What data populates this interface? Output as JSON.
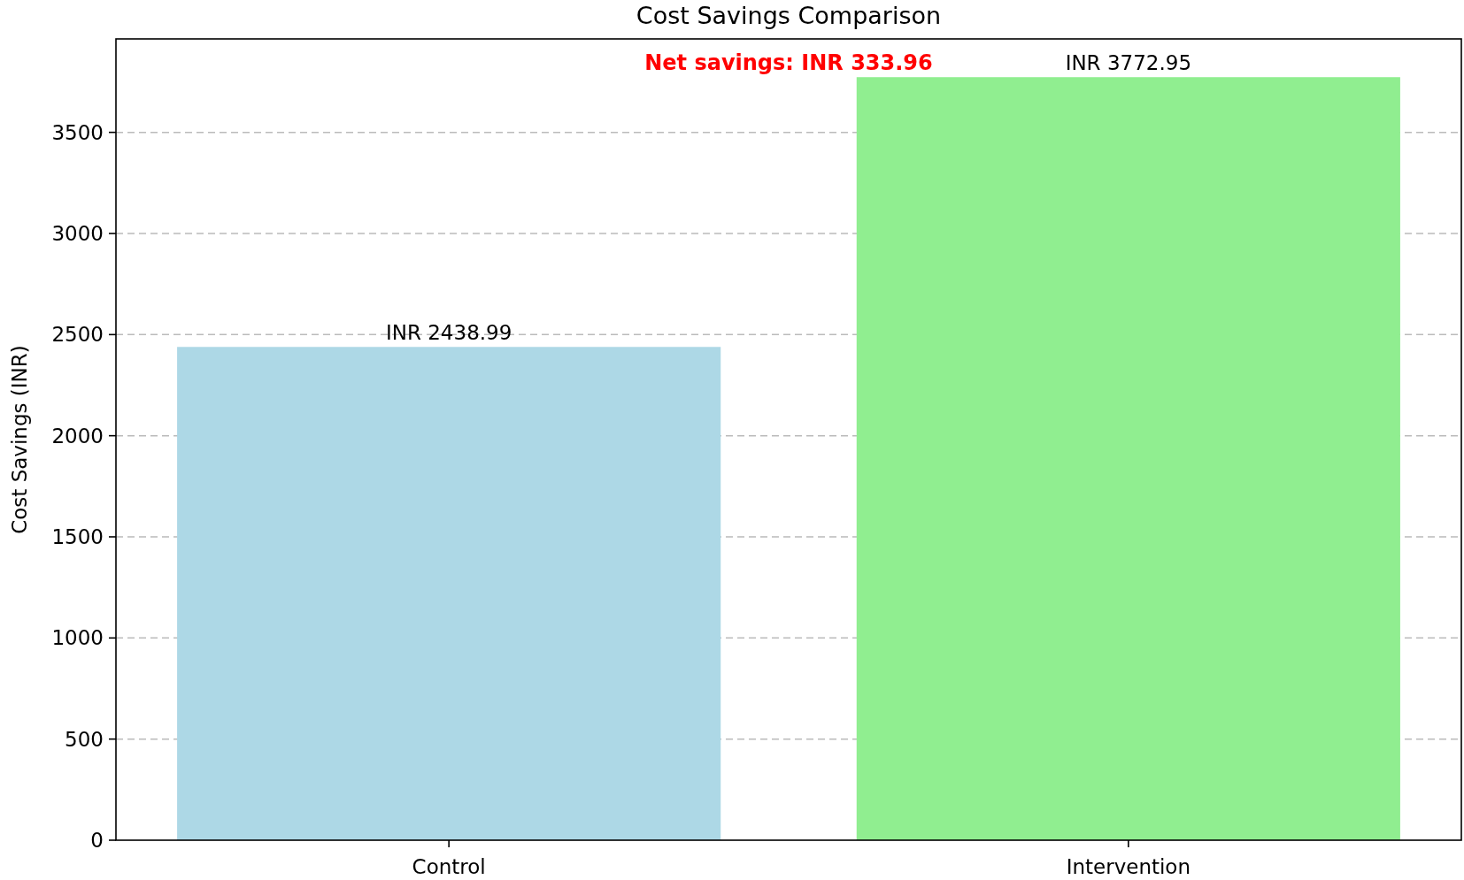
{
  "chart_data": {
    "type": "bar",
    "title": "Cost Savings Comparison",
    "ylabel": "Cost Savings (INR)",
    "categories": [
      "Control",
      "Intervention"
    ],
    "values": [
      2438.99,
      3772.95
    ],
    "colors": [
      "#add8e6",
      "#90ee90"
    ],
    "ylim": [
      0,
      3962
    ],
    "grid": true,
    "yticks": [
      0,
      500,
      1000,
      1500,
      2000,
      2500,
      3000,
      3500
    ],
    "value_labels": [
      "INR 2438.99",
      "INR 3772.95"
    ],
    "annotations": [
      "Net savings: INR 333.96"
    ]
  }
}
